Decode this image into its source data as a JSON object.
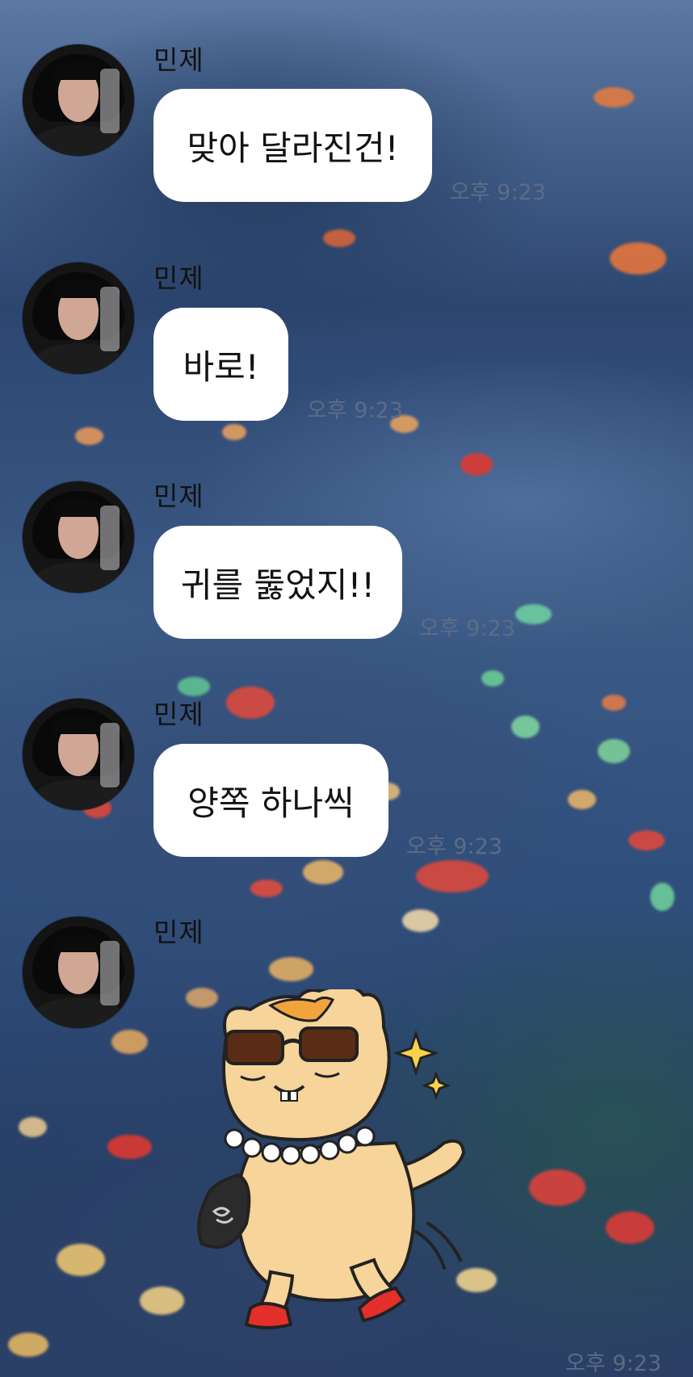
{
  "sender_name": "민제",
  "messages": [
    {
      "sender": "민제",
      "text": "맞아 달라진건!",
      "time": "오후 9:23"
    },
    {
      "sender": "민제",
      "text": "바로!",
      "time": "오후 9:23"
    },
    {
      "sender": "민제",
      "text": "귀를 뚫었지!!",
      "time": "오후 9:23"
    },
    {
      "sender": "민제",
      "text": "양쪽 하나씩",
      "time": "오후 9:23"
    }
  ],
  "sticker_message": {
    "sender": "민제",
    "sticker": "hamster-with-sunglasses-pearls-heels-icon",
    "time": "오후 9:23"
  },
  "colors": {
    "bubble": "#ffffff",
    "text": "#121212",
    "timestamp": "#5f6e87"
  }
}
